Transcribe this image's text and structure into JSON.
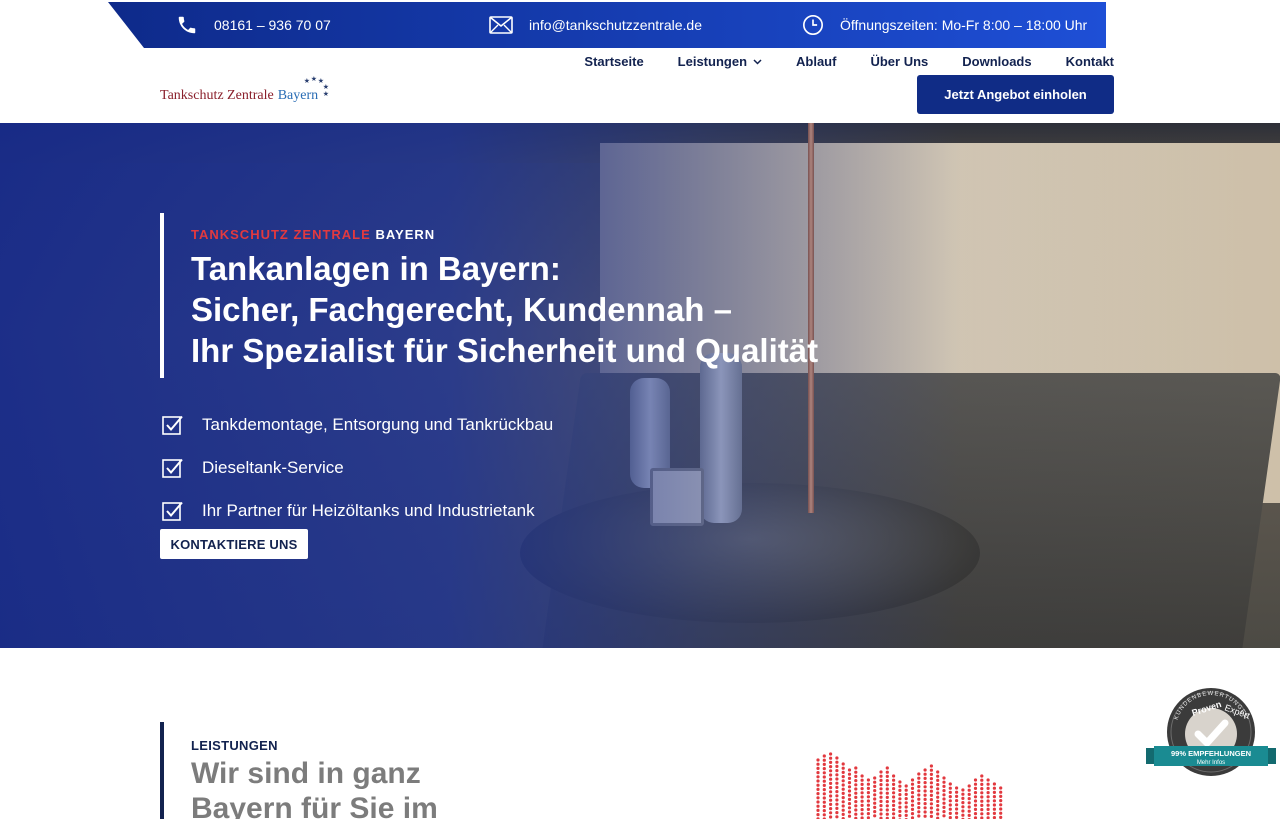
{
  "topbar": {
    "phone": "08161 – 936 70 07",
    "email": "info@tankschutzzentrale.de",
    "hours": "Öffnungszeiten: Mo-Fr 8:00 – 18:00 Uhr"
  },
  "logo": {
    "part1": "Tankschutz Zentrale",
    "part2": "Bayern"
  },
  "nav": {
    "items": [
      "Startseite",
      "Leistungen",
      "Ablauf",
      "Über Uns",
      "Downloads",
      "Kontakt"
    ],
    "cta": "Jetzt Angebot einholen"
  },
  "hero": {
    "eyebrow_red": "TANKSCHUTZ ZENTRALE",
    "eyebrow_white": "BAYERN",
    "title_line1": "Tankanlagen in Bayern:",
    "title_line2": "Sicher, Fachgerecht, Kundennah –",
    "title_line3": "Ihr Spezialist für Sicherheit und Qualität",
    "checks": [
      "Tankdemontage, Entsorgung und Tankrückbau",
      "Dieseltank-Service",
      "Ihr Partner für Heizöltanks und Industrietank"
    ],
    "button": "KONTAKTIERE UNS"
  },
  "section": {
    "eyebrow": "LEISTUNGEN",
    "title": "Wir sind in ganz Bayern für Sie im"
  },
  "badge": {
    "ring_text": "KUNDENBEWERTUNGEN",
    "brand1": "Proven",
    "brand2": "Expert",
    "ribbon": "99% EMPFEHLUNGEN",
    "more": "Mehr Infos"
  },
  "colors": {
    "primary": "#102c86",
    "accent_red": "#e2393f",
    "logo_red": "#8a1f2b",
    "logo_blue": "#2a6db5"
  }
}
